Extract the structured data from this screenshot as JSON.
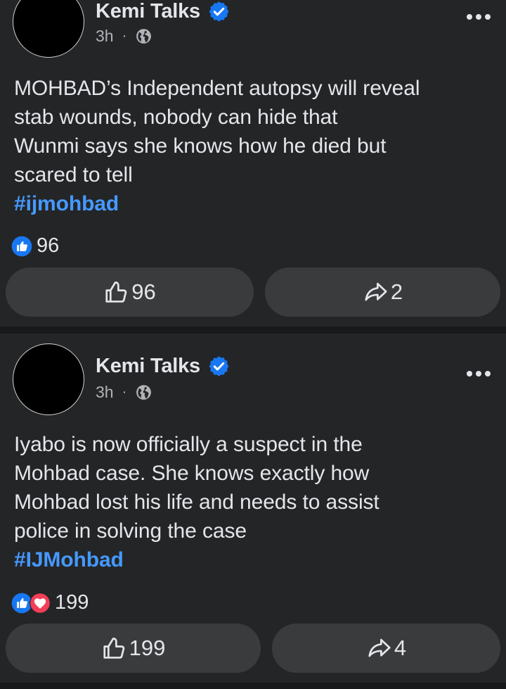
{
  "posts": [
    {
      "author": "Kemi Talks",
      "time": "3h",
      "separator": "·",
      "lines": [
        "MOHBAD’s Independent autopsy will reveal",
        "stab wounds, nobody can hide that",
        "Wunmi says she knows how he died but",
        "scared to tell"
      ],
      "hashtag": "#ijmohbad",
      "reaction_count": "96",
      "like_count": "96",
      "share_count": "2"
    },
    {
      "author": "Kemi Talks",
      "time": "3h",
      "separator": "·",
      "lines": [
        "Iyabo is now officially a suspect in the",
        "Mohbad case. She knows exactly how",
        "Mohbad lost his life and needs to assist",
        "police in solving the case"
      ],
      "hashtag": "#IJMohbad",
      "reaction_count": "199",
      "like_count": "199",
      "share_count": "4"
    }
  ],
  "colors": {
    "background": "#242526",
    "separator": "#18191a",
    "button": "#3a3b3c",
    "text": "#e4e6eb",
    "secondary_text": "#b0b3b8",
    "hashtag": "#4599ff",
    "like_blue": "#1877f2",
    "love_red": "#f33e58"
  },
  "icons": {
    "verified": "verified-badge-icon",
    "audience": "globe-icon",
    "menu": "more-options-icon",
    "like_reaction": "like-reaction-icon",
    "love_reaction": "love-reaction-icon",
    "like_action": "thumbs-up-outline-icon",
    "share_action": "share-arrow-icon"
  }
}
